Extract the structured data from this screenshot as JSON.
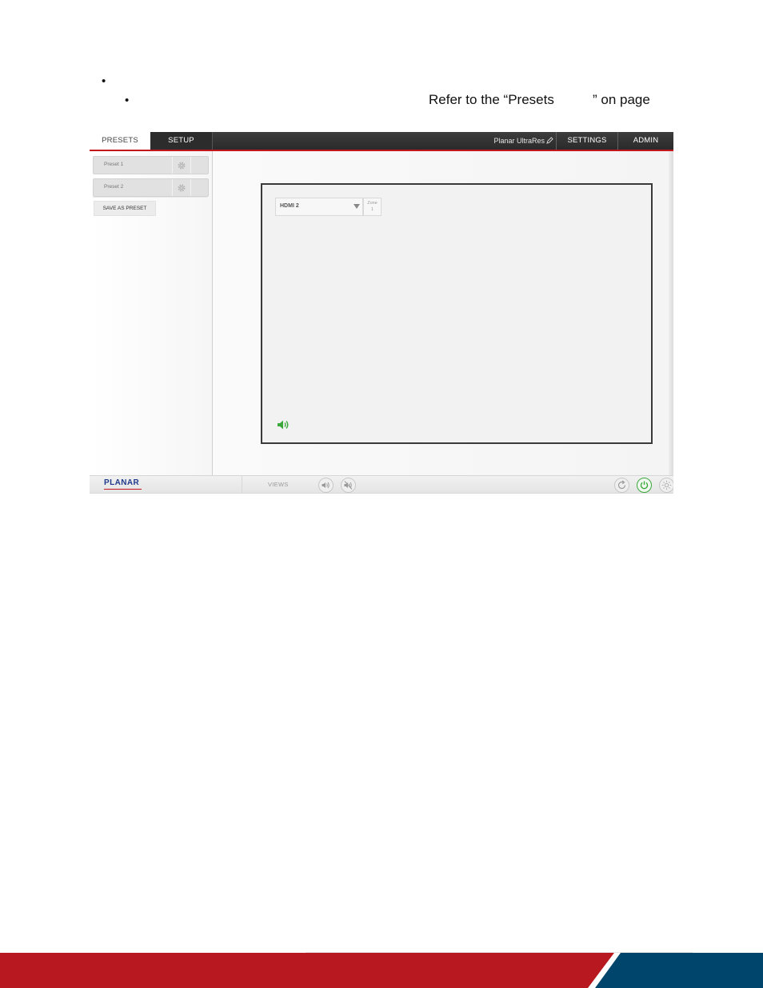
{
  "document": {
    "bullet_1": "•",
    "bullet_2": "•",
    "refer_text": "Refer to the “Presets",
    "on_page_text": "” on page"
  },
  "ui": {
    "tabs": {
      "presets": "PRESETS",
      "setup": "SETUP"
    },
    "device_name": "Planar UltraRes",
    "header_buttons": {
      "settings": "SETTINGS",
      "admin": "ADMIN"
    },
    "presets": [
      {
        "label": "Preset 1"
      },
      {
        "label": "Preset 2"
      }
    ],
    "save_preset_label": "SAVE AS PRESET",
    "zone": {
      "source": "HDMI 2",
      "zone_word": "Zone",
      "zone_number": "1"
    },
    "footer": {
      "logo": "PLANAR",
      "views_label": "VIEWS"
    },
    "icons": [
      "pencil-icon",
      "gear-icon",
      "caret-down-icon",
      "volume-icon",
      "volume-up-icon",
      "mute-icon",
      "refresh-icon",
      "power-icon",
      "brightness-icon"
    ],
    "colors": {
      "accent_red": "#c4161c",
      "active_green": "#3aa83a",
      "brand_blue": "#1f3a8a",
      "footer_blue": "#00456b"
    }
  }
}
